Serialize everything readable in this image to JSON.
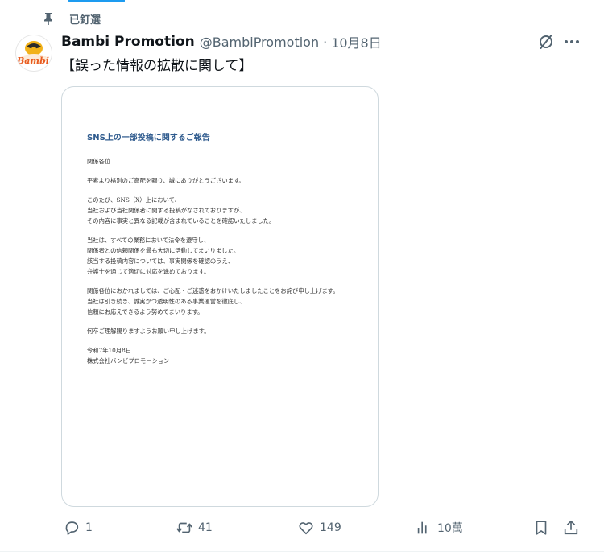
{
  "pinned_label": "已釘選",
  "author": {
    "name": "Bambi Promotion",
    "handle": "@BambiPromotion",
    "separator": "·",
    "date": "10月8日",
    "avatar_text": "Bambi"
  },
  "post_text": "【誤った情報の拡散に関して】",
  "document": {
    "title": "SNS上の一部投稿に関するご報告",
    "greeting": "関係各位",
    "para1": "平素より格別のご高配を賜り、誠にありがとうございます。",
    "para2": [
      "このたび、SNS（X）上において、",
      "当社および当社関係者に関する投稿がなされておりますが、",
      "その内容に事実と異なる記載が含まれていることを確認いたしました。"
    ],
    "para3": [
      "当社は、すべての業務において法令を遵守し、",
      "関係者との信頼関係を最も大切に活動してまいりました。",
      "該当する投稿内容については、事実関係を確認のうえ、",
      "弁護士を通じて適切に対応を進めております。"
    ],
    "para4": [
      "関係各位におかれましては、ご心配・ご迷惑をおかけいたしましたことをお詫び申し上げます。",
      "当社は引き続き、誠実かつ透明性のある事業運営を徹底し、",
      "信頼にお応えできるよう努めてまいります。"
    ],
    "para5": "何卒ご理解賜りますようお願い申し上げます。",
    "date": "令和7年10月8日",
    "company": "株式会社バンビプロモーション"
  },
  "actions": {
    "replies": "1",
    "reposts": "41",
    "likes": "149",
    "views": "10萬"
  },
  "colors": {
    "accent": "#1d9bf0",
    "text": "#0f1419",
    "muted": "#536471",
    "border": "#cfd9de",
    "doc_title": "#2f5b8e"
  },
  "icons": [
    "pin-icon",
    "grok-icon",
    "more-icon",
    "reply-icon",
    "repost-icon",
    "like-icon",
    "views-icon",
    "bookmark-icon",
    "share-icon"
  ]
}
